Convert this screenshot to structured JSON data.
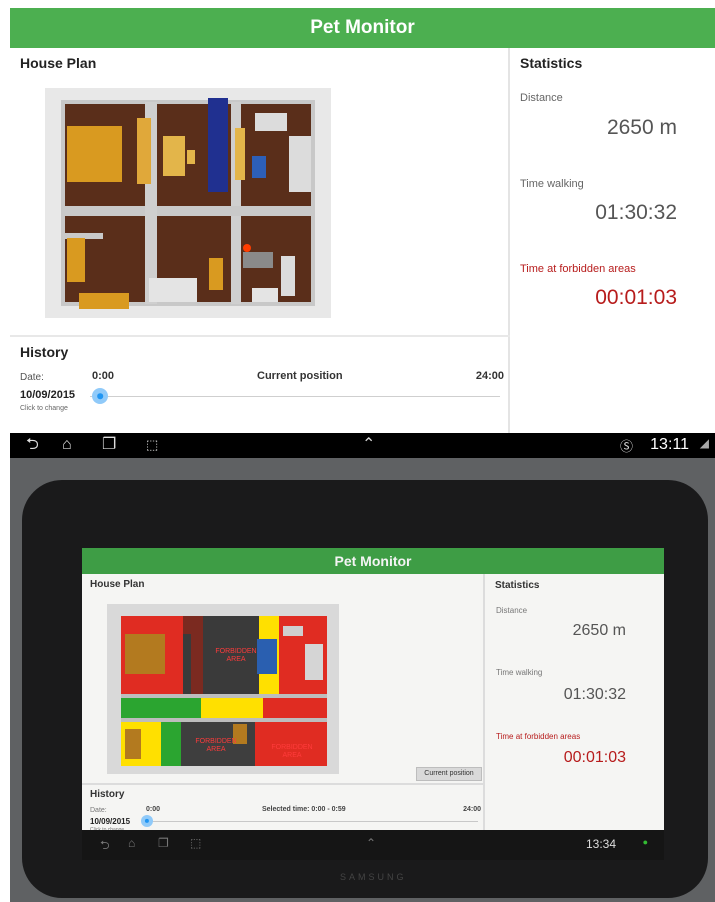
{
  "app_title": "Pet Monitor",
  "house_plan": {
    "title": "House Plan"
  },
  "statistics": {
    "title": "Statistics",
    "distance_label": "Distance",
    "distance_value": "2650 m",
    "time_walking_label": "Time walking",
    "time_walking_value": "01:30:32",
    "forbidden_label": "Time at forbidden areas",
    "forbidden_value": "00:01:03"
  },
  "history": {
    "title": "History",
    "date_label": "Date:",
    "date_value": "10/09/2015",
    "date_hint": "Click to change",
    "start_time": "0:00",
    "end_time": "24:00",
    "center_label": "Current position",
    "slider_position": 0.01
  },
  "status_bar": {
    "clock": "13:11"
  },
  "tablet": {
    "app_title": "Pet Monitor",
    "house_plan_title": "House Plan",
    "current_position_button": "Current position",
    "forbidden_area_text": "FORBIDDEN AREA",
    "statistics": {
      "title": "Statistics",
      "distance_label": "Distance",
      "distance_value": "2650 m",
      "time_walking_label": "Time walking",
      "time_walking_value": "01:30:32",
      "forbidden_label": "Time at forbidden areas",
      "forbidden_value": "00:01:03"
    },
    "history": {
      "title": "History",
      "date_label": "Date:",
      "date_value": "10/09/2015",
      "date_hint": "Click to change",
      "start_time": "0:00",
      "end_time": "24:00",
      "center_label": "Selected time: 0:00 - 0:59"
    },
    "clock": "13:34",
    "brand": "SAMSUNG"
  },
  "colors": {
    "app_bar": "#4caf50",
    "forbidden_text": "#b71c1c",
    "slider_thumb": "#2196f3",
    "pet_marker": "#ff3d00"
  }
}
